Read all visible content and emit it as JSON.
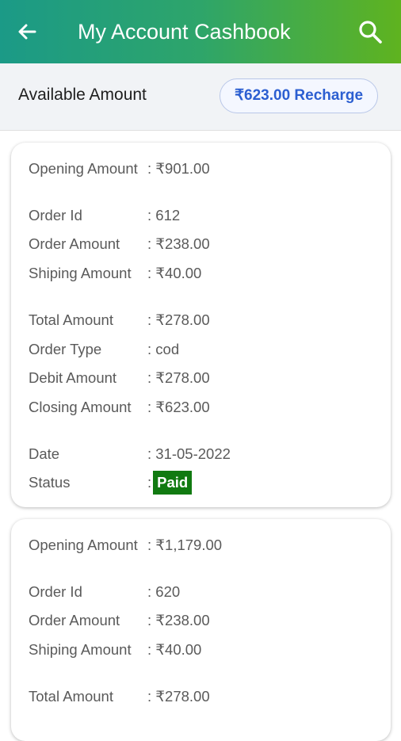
{
  "header": {
    "title": "My Account Cashbook",
    "back_icon": "arrow-left-icon",
    "search_icon": "search-icon",
    "gradient": [
      "#1b9a87",
      "#5fb31f"
    ]
  },
  "available": {
    "label": "Available Amount",
    "recharge_label": "₹623.00 Recharge"
  },
  "entries": [
    {
      "opening_label": "Opening Amount",
      "opening_value": ": ₹901.00",
      "order_id_label": "Order Id",
      "order_id_value": ": 612",
      "order_amount_label": "Order Amount",
      "order_amount_value": ": ₹238.00",
      "shipping_label": "Shiping Amount",
      "shipping_value": ": ₹40.00",
      "total_label": "Total Amount",
      "total_value": ": ₹278.00",
      "order_type_label": "Order Type",
      "order_type_value": ": cod",
      "debit_label": "Debit Amount",
      "debit_value": ": ₹278.00",
      "closing_label": "Closing Amount",
      "closing_value": ": ₹623.00",
      "date_label": "Date",
      "date_value": ": 31-05-2022",
      "status_label": "Status",
      "status_colon": ":",
      "status_value": "Paid",
      "status_color": "#117a11"
    },
    {
      "opening_label": "Opening Amount",
      "opening_value": ": ₹1,179.00",
      "order_id_label": "Order Id",
      "order_id_value": ": 620",
      "order_amount_label": "Order Amount",
      "order_amount_value": ": ₹238.00",
      "shipping_label": "Shiping Amount",
      "shipping_value": ": ₹40.00",
      "total_label": "Total Amount",
      "total_value": ": ₹278.00"
    }
  ]
}
